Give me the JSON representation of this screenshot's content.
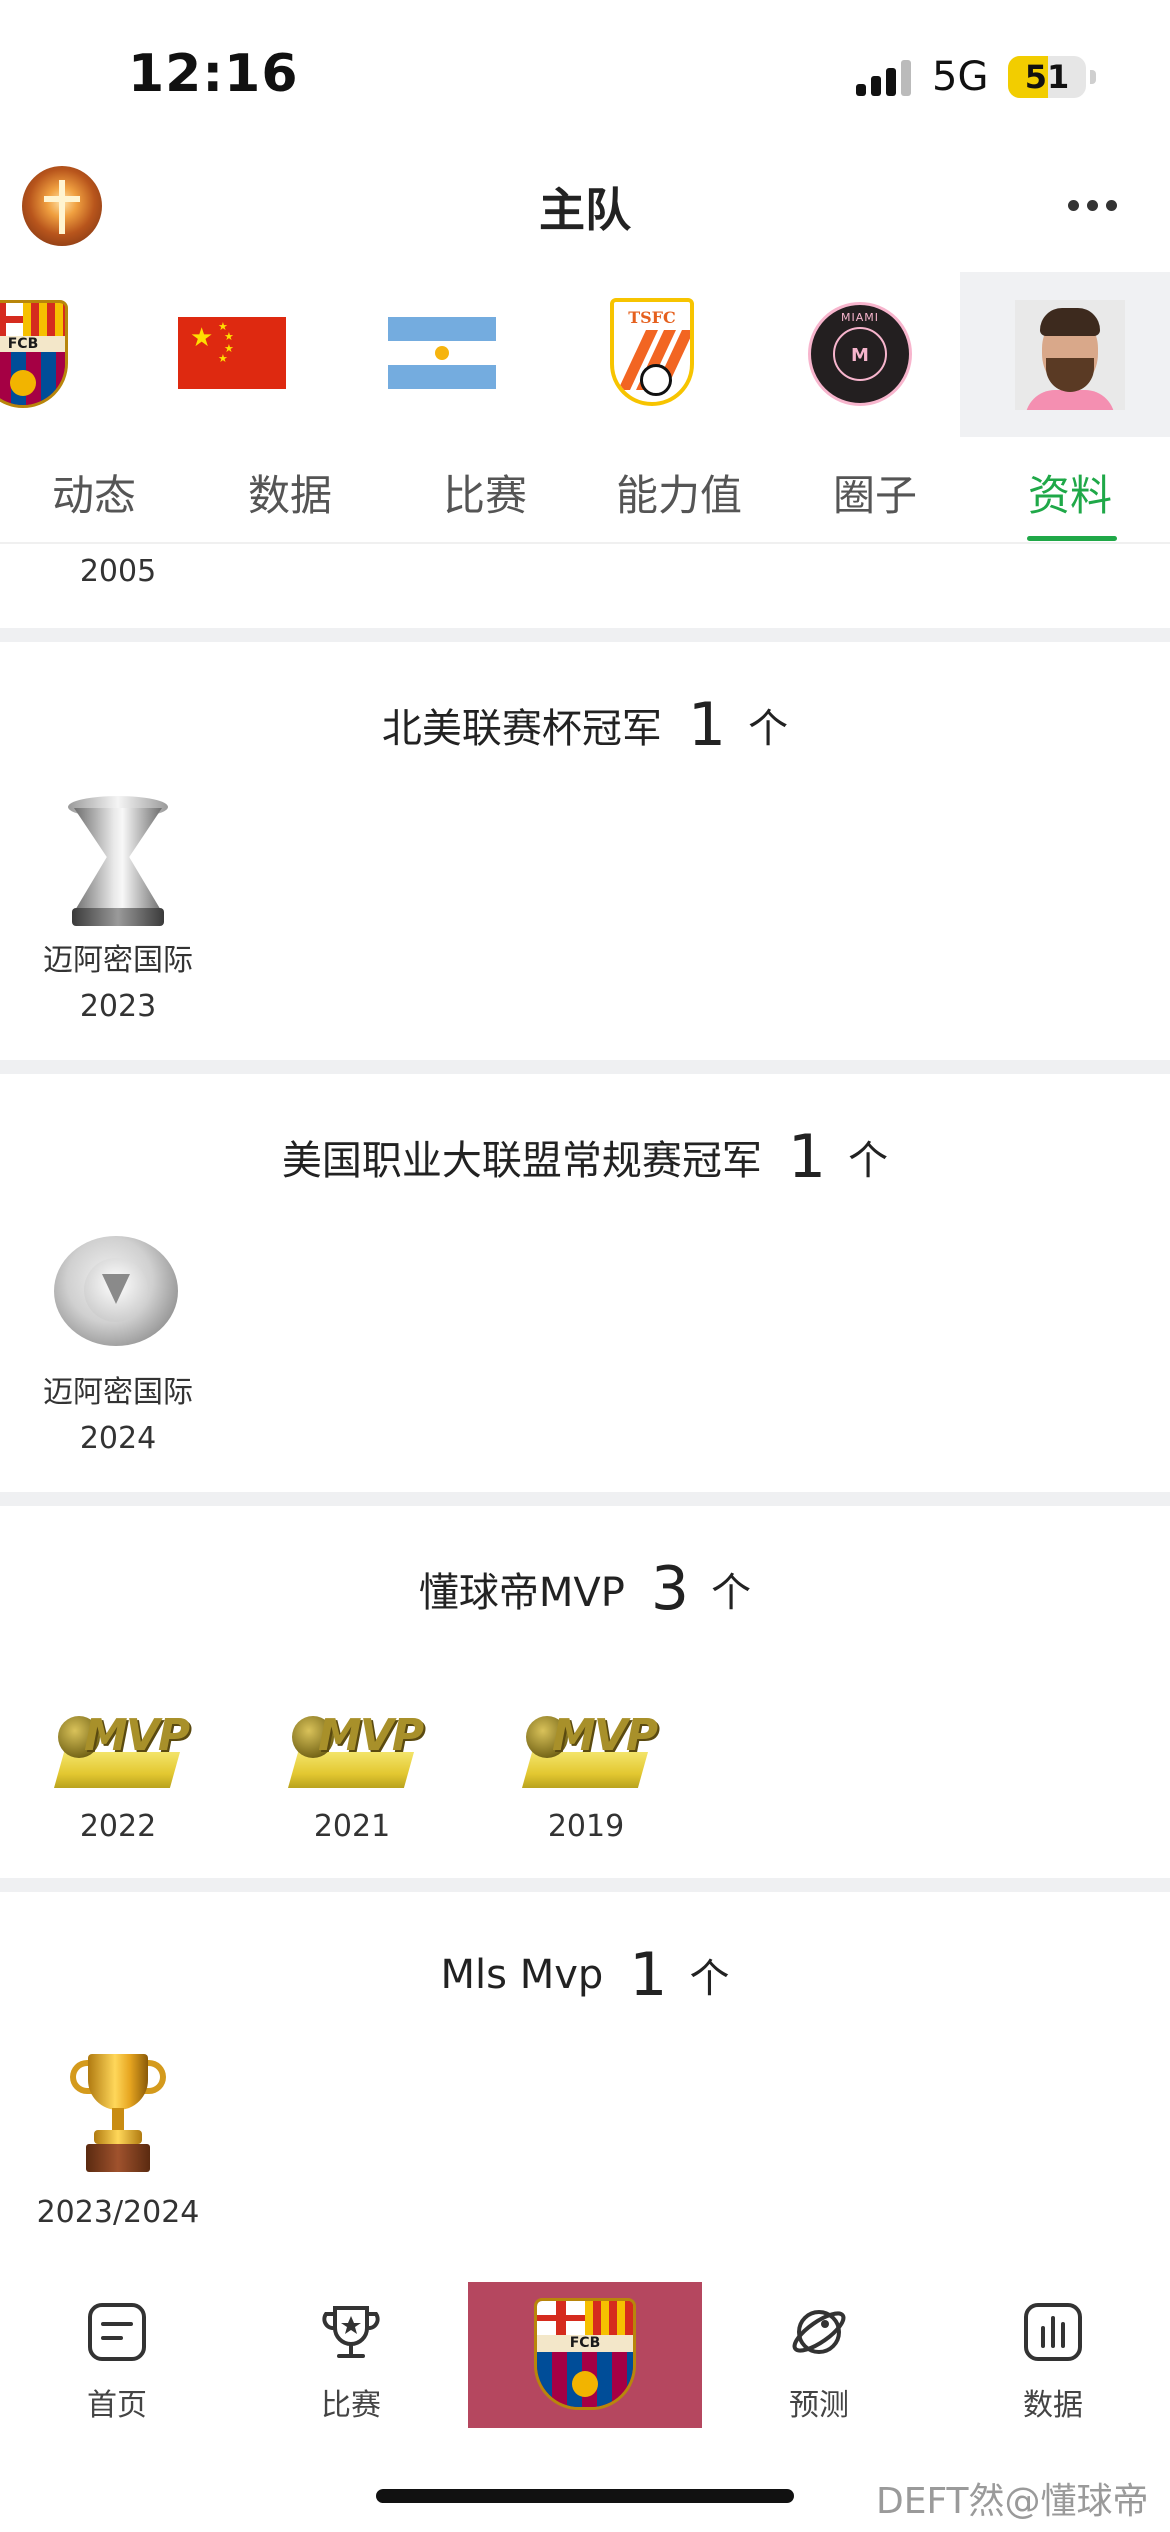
{
  "status_bar": {
    "time": "12:16",
    "network": "5G",
    "battery_level": "51",
    "battery_fraction": 0.51
  },
  "header": {
    "title": "主队",
    "avatar_icon": "cross-sunset-avatar",
    "more_icon": "more-dots-icon"
  },
  "teams": [
    {
      "name": "FC Barcelona",
      "icon": "barcelona-crest",
      "crest_text": "FCB"
    },
    {
      "name": "China",
      "icon": "china-flag"
    },
    {
      "name": "Argentina",
      "icon": "argentina-flag"
    },
    {
      "name": "Shandong Taishan",
      "icon": "tsfc-crest",
      "crest_text": "TSFC"
    },
    {
      "name": "Inter Miami",
      "icon": "inter-miami-crest",
      "crest_text": "MIAMI"
    },
    {
      "name": "Messi",
      "icon": "player-photo",
      "selected": true
    }
  ],
  "tabs": [
    {
      "label": "动态"
    },
    {
      "label": "数据"
    },
    {
      "label": "比赛"
    },
    {
      "label": "能力值"
    },
    {
      "label": "圈子"
    },
    {
      "label": "资料",
      "active": true
    }
  ],
  "colors": {
    "accent_green": "#1fa848",
    "nav_center_bg": "#b5475f",
    "divider": "#eff0f2"
  },
  "content": {
    "previous_year": "2005",
    "sections": [
      {
        "title": "北美联赛杯冠军",
        "count": "1",
        "unit": "个",
        "items": [
          {
            "icon": "leagues-cup-trophy",
            "team": "迈阿密国际",
            "year": "2023"
          }
        ]
      },
      {
        "title": "美国职业大联盟常规赛冠军",
        "count": "1",
        "unit": "个",
        "items": [
          {
            "icon": "supporters-shield-trophy",
            "team": "迈阿密国际",
            "year": "2024"
          }
        ]
      },
      {
        "title": "懂球帝MVP",
        "count": "3",
        "unit": "个",
        "items": [
          {
            "icon": "mvp-trophy",
            "year": "2022"
          },
          {
            "icon": "mvp-trophy",
            "year": "2021"
          },
          {
            "icon": "mvp-trophy",
            "year": "2019"
          }
        ],
        "trophy_text": "MVP"
      },
      {
        "title": "Mls Mvp",
        "count": "1",
        "unit": "个",
        "items": [
          {
            "icon": "gold-cup-trophy",
            "year": "2023/2024"
          }
        ]
      }
    ]
  },
  "bottom_nav": [
    {
      "label": "首页",
      "icon": "home-doc-icon"
    },
    {
      "label": "比赛",
      "icon": "trophy-star-icon"
    },
    {
      "label": "",
      "icon": "barcelona-crest"
    },
    {
      "label": "预测",
      "icon": "planet-icon"
    },
    {
      "label": "数据",
      "icon": "bar-chart-icon"
    }
  ],
  "watermark": "DEFT然@懂球帝"
}
